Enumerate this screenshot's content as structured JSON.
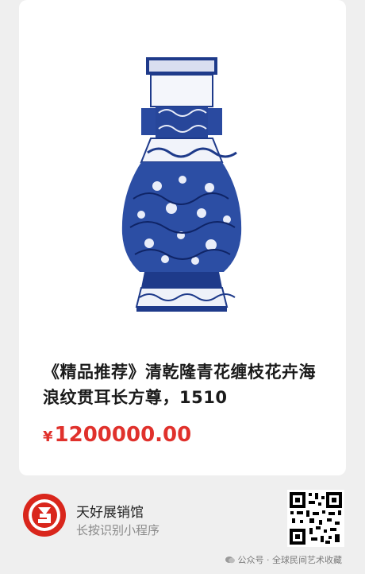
{
  "product": {
    "title": "《精品推荐》清乾隆青花缠枝花卉海浪纹贯耳长方尊，1510",
    "price_symbol": "¥",
    "price_value": "1200000.00"
  },
  "mini_program": {
    "shop_name": "天好展销馆",
    "hint": "长按识别小程序"
  },
  "watermark": {
    "text": "公众号 · 全球民间艺术收藏"
  },
  "colors": {
    "price": "#e0312c",
    "logo_red": "#d9261c",
    "porcelain_blue": "#1e3a8a"
  },
  "icons": [
    "vase-image",
    "brand-logo-icon",
    "qr-code-icon",
    "wechat-icon"
  ]
}
